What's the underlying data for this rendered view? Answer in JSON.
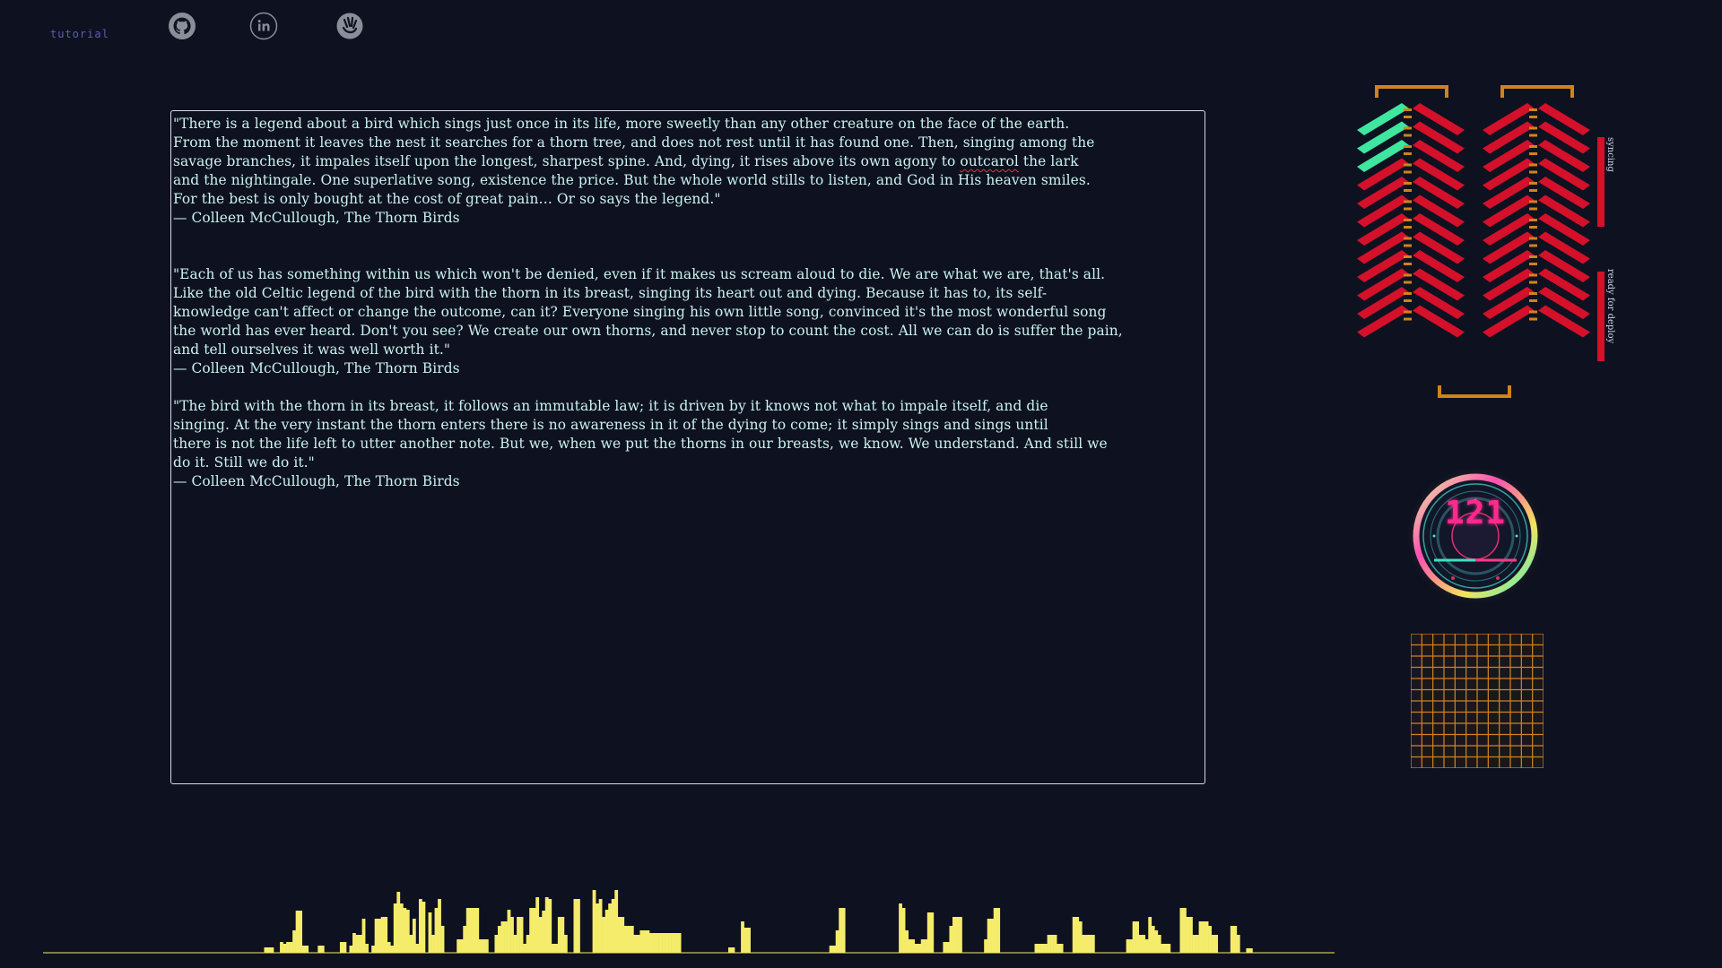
{
  "nav": {
    "tutorial_label": "tutorial",
    "icons": [
      "github-icon",
      "linkedin-icon",
      "hand-logo-icon"
    ]
  },
  "editor": {
    "quotes": [
      {
        "lines": [
          "\"There is a legend about a bird which sings just once in its life, more sweetly than any other creature on the face of the earth.",
          "From the moment it leaves the nest it searches for a thorn tree, and does not rest until it has found one. Then, singing among the",
          "savage branches, it impales itself upon the longest, sharpest spine. And, dying, it rises above its own agony to ",
          "and the nightingale. One superlative song, existence the price. But the whole world stills to listen, and God in His heaven smiles.",
          "For the best is only bought at the cost of great pain… Or so says the legend.\""
        ],
        "misspelled_word": "outcarol",
        "misspelled_tail": " the lark",
        "attribution": "— Colleen McCullough, The Thorn Birds"
      },
      {
        "lines": [
          "\"Each of us has something within us which won't be denied, even if it makes us scream aloud to die. We are what we are, that's all.",
          "Like the old Celtic legend of the bird with the thorn in its breast, singing its heart out and dying. Because it has to, its self-",
          "knowledge can't affect or change the outcome, can it? Everyone singing his own little song, convinced it's the most wonderful song",
          "the world has ever heard. Don't you see? We create our own thorns, and never stop to count the cost. All we can do is suffer the pain,",
          "and tell ourselves it was well worth it.\""
        ],
        "attribution": "— Colleen McCullough, The Thorn Birds"
      },
      {
        "lines": [
          "\"The bird with the thorn in its breast, it follows an immutable law; it is driven by it knows not what to impale itself, and die",
          "singing. At the very instant the thorn enters there is no awareness in it of the dying to come; it simply sings and sings until",
          "there is not the life left to utter another note. But we, when we put the thorns in our breasts, we know. We understand. And still we",
          "do it. Still we do it.\""
        ],
        "attribution": "— Colleen McCullough, The Thorn Birds"
      }
    ]
  },
  "status": {
    "syncing_label": "syncing",
    "deploy_label": "ready for deploy",
    "syncing_level": 1.0,
    "deploy_level": 1.0,
    "stack_rows": 12,
    "left_stack_done_rows": 3
  },
  "counter": {
    "value": "121"
  },
  "colors": {
    "background": "#0e1120",
    "text": "#c9f3ee",
    "accent_red": "#d4102a",
    "accent_orange": "#d0831c",
    "accent_green": "#3ee6a0",
    "accent_pink": "#ff2a8d",
    "visualizer": "#f4ec6a"
  },
  "visualizer": {
    "levels": [
      0,
      0,
      0,
      0,
      0,
      0,
      0,
      0,
      0,
      0,
      0,
      0,
      0,
      0,
      0,
      0,
      0,
      0,
      0,
      0,
      0,
      0,
      0,
      0,
      0,
      0,
      0,
      0,
      0,
      0,
      0,
      0,
      0,
      0,
      0,
      0,
      0,
      0,
      0,
      0,
      0,
      0,
      0,
      0,
      0,
      0,
      0,
      0,
      0,
      0,
      0,
      0,
      0,
      0,
      0,
      0,
      0,
      0,
      0,
      0,
      0,
      0,
      0,
      0,
      0,
      0,
      0,
      0,
      0,
      0,
      6,
      6,
      6,
      0,
      0,
      12,
      10,
      12,
      12,
      25,
      47,
      47,
      8,
      8,
      0,
      0,
      0,
      8,
      8,
      0,
      0,
      0,
      0,
      0,
      12,
      12,
      0,
      8,
      22,
      20,
      20,
      38,
      10,
      0,
      8,
      38,
      38,
      40,
      40,
      12,
      8,
      55,
      68,
      55,
      50,
      48,
      20,
      38,
      10,
      60,
      57,
      0,
      45,
      20,
      50,
      60,
      30,
      0,
      0,
      0,
      0,
      15,
      15,
      30,
      50,
      50,
      50,
      50,
      15,
      15,
      15,
      0,
      0,
      20,
      30,
      35,
      35,
      48,
      40,
      20,
      40,
      40,
      10,
      20,
      50,
      50,
      62,
      40,
      47,
      62,
      60,
      10,
      10,
      40,
      40,
      20,
      0,
      0,
      60,
      60,
      0,
      0,
      0,
      0,
      70,
      55,
      60,
      40,
      48,
      55,
      60,
      70,
      40,
      40,
      30,
      30,
      30,
      20,
      20,
      25,
      25,
      25,
      22,
      22,
      22,
      22,
      22,
      22,
      22,
      22,
      22,
      22,
      0,
      0,
      0,
      0,
      0,
      0,
      0,
      0,
      0,
      0,
      0,
      0,
      0,
      0,
      0,
      6,
      6,
      0,
      0,
      35,
      28,
      28,
      0,
      0,
      0,
      0,
      0,
      0,
      0,
      0,
      0,
      0,
      0,
      0,
      0,
      0,
      0,
      0,
      0,
      0,
      0,
      0,
      0,
      0,
      0,
      0,
      0,
      8,
      8,
      25,
      50,
      50,
      0,
      0,
      0,
      0,
      0,
      0,
      0,
      0,
      0,
      0,
      0,
      0,
      0,
      0,
      0,
      0,
      0,
      55,
      50,
      25,
      15,
      15,
      10,
      10,
      15,
      15,
      45,
      45,
      0,
      0,
      0,
      12,
      12,
      30,
      40,
      40,
      40,
      0,
      0,
      0,
      0,
      0,
      0,
      0,
      15,
      38,
      38,
      50,
      50,
      0,
      0,
      0,
      0,
      0,
      0,
      0,
      0,
      0,
      0,
      0,
      10,
      10,
      10,
      10,
      20,
      20,
      20,
      10,
      10,
      0,
      0,
      0,
      40,
      40,
      35,
      20,
      20,
      20,
      20,
      0,
      0,
      0,
      0,
      0,
      0,
      0,
      0,
      0,
      0,
      15,
      15,
      35,
      35,
      20,
      20,
      15,
      40,
      30,
      25,
      20,
      10,
      10,
      10,
      0,
      0,
      0,
      50,
      50,
      40,
      40,
      20,
      20,
      35,
      35,
      35,
      30,
      20,
      20,
      0,
      0,
      0,
      0,
      30,
      30,
      20,
      0,
      0,
      5,
      5,
      0,
      0,
      0,
      0,
      0,
      0,
      0,
      0,
      0,
      0,
      0,
      0,
      0,
      0,
      0,
      0,
      0,
      0,
      0,
      0,
      0,
      0,
      0,
      0,
      0,
      0
    ]
  }
}
